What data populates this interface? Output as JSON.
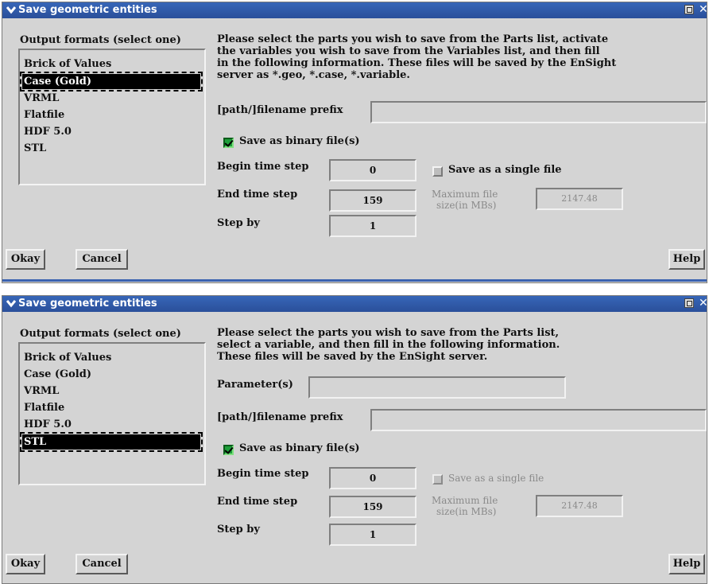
{
  "dialogs": [
    {
      "title": "Save geometric entities",
      "formats_label": "Output formats (select one)",
      "formats": [
        "Brick of Values",
        "Case (Gold)",
        "VRML",
        "Flatfile",
        "HDF 5.0",
        "STL"
      ],
      "selected_format": "Case (Gold)",
      "description": [
        "Please select the parts you wish to save from the Parts list, activate",
        "the variables you wish to save from the Variables list, and then fill",
        "in the following information. These files will be saved by the EnSight",
        "server as *.geo, *.case, *.variable."
      ],
      "prefix_label": "[path/]filename prefix",
      "prefix_value": "",
      "binary_label": "Save as binary file(s)",
      "binary_checked": true,
      "begin_label": "Begin time step",
      "begin_value": "0",
      "end_label": "End time step",
      "end_value": "159",
      "step_label": "Step by",
      "step_value": "1",
      "single_label": "Save as a single file",
      "single_checked": false,
      "maxsize_label_1": "Maximum file",
      "maxsize_label_2": "size(in MBs)",
      "maxsize_value": "2147.48",
      "okay": "Okay",
      "cancel": "Cancel",
      "help": "Help"
    },
    {
      "title": "Save geometric entities",
      "formats_label": "Output formats (select one)",
      "formats": [
        "Brick of Values",
        "Case (Gold)",
        "VRML",
        "Flatfile",
        "HDF 5.0",
        "STL"
      ],
      "selected_format": "STL",
      "description": [
        "Please select the parts you wish to save from the Parts list,",
        "select a variable, and then fill in the following information.",
        "These files will be saved by the EnSight server."
      ],
      "params_label": "Parameter(s)",
      "params_value": "",
      "prefix_label": "[path/]filename prefix",
      "prefix_value": "",
      "binary_label": "Save as binary file(s)",
      "binary_checked": true,
      "begin_label": "Begin time step",
      "begin_value": "0",
      "end_label": "End time step",
      "end_value": "159",
      "step_label": "Step by",
      "step_value": "1",
      "single_label": "Save as a single file",
      "single_checked": false,
      "maxsize_label_1": "Maximum file",
      "maxsize_label_2": "size(in MBs)",
      "maxsize_value": "2147.48",
      "okay": "Okay",
      "cancel": "Cancel",
      "help": "Help"
    }
  ]
}
